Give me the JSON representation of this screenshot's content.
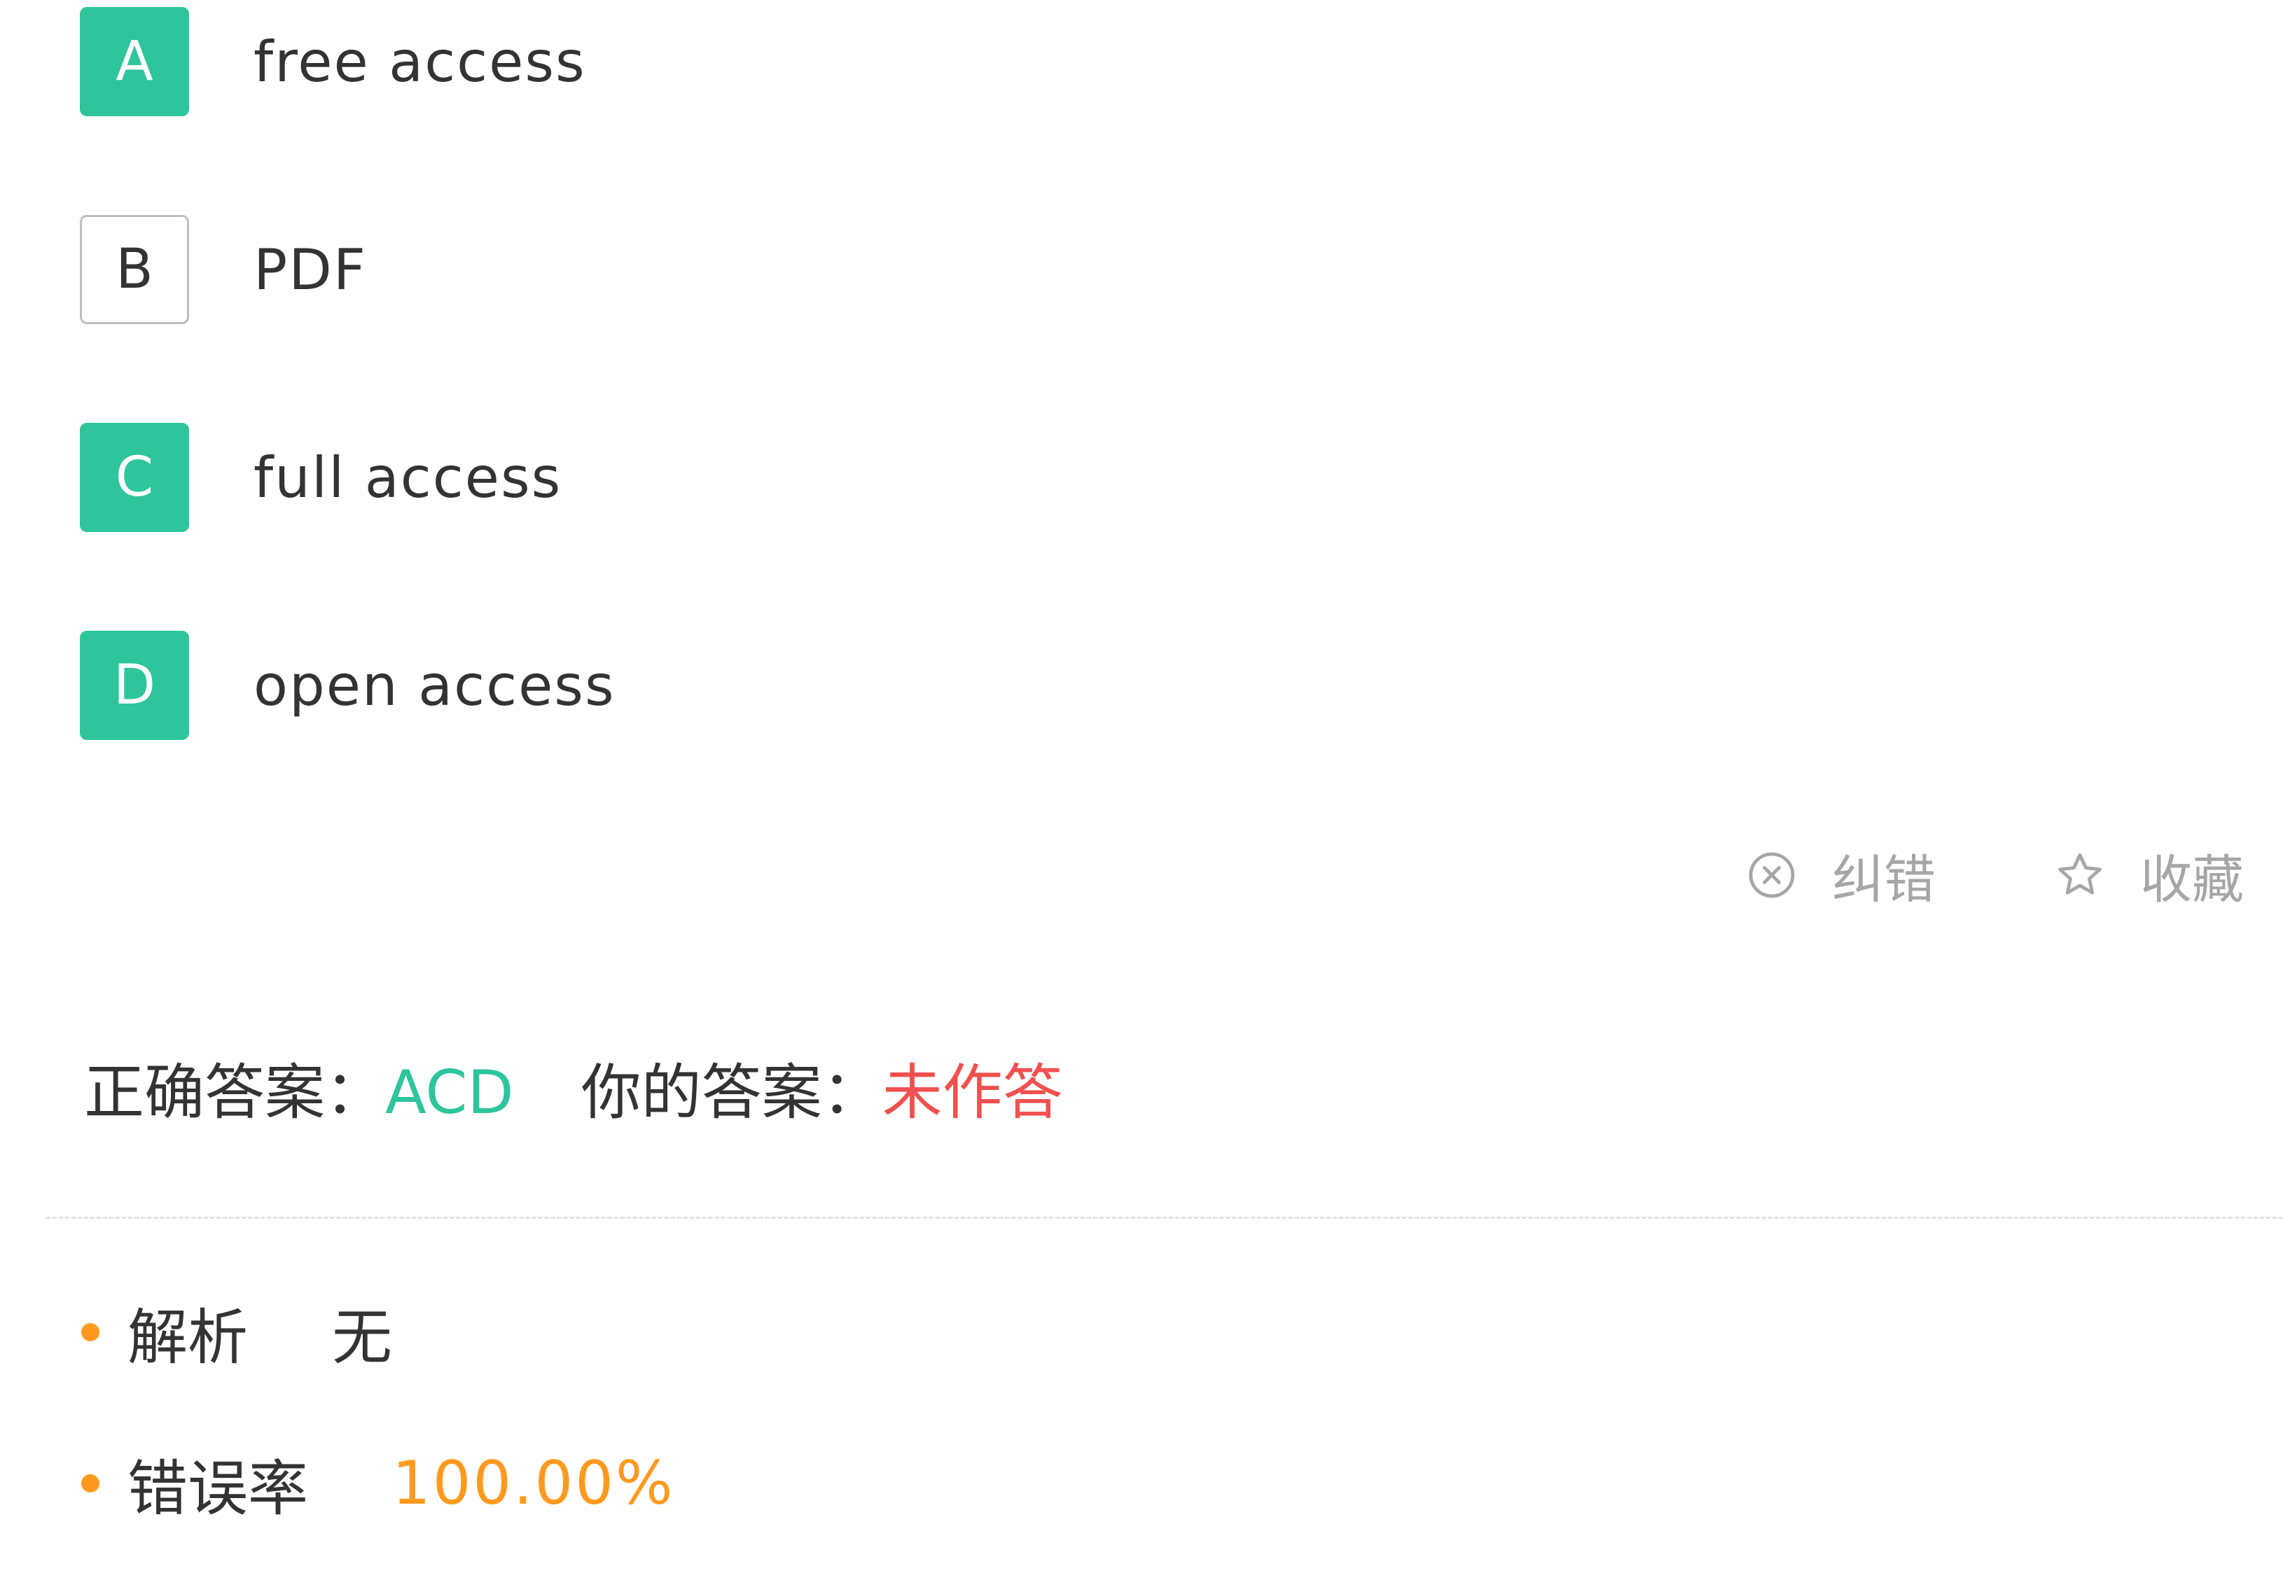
{
  "options": [
    {
      "letter": "A",
      "text": "free access",
      "selected": true
    },
    {
      "letter": "B",
      "text": "PDF",
      "selected": false
    },
    {
      "letter": "C",
      "text": "full access",
      "selected": true
    },
    {
      "letter": "D",
      "text": "open access",
      "selected": true
    }
  ],
  "actions": {
    "report_label": "纠错",
    "report_icon": "close-circle-icon",
    "favorite_label": "收藏",
    "favorite_icon": "star-outline-icon"
  },
  "answer": {
    "correct_label": "正确答案：",
    "correct_value": "ACD",
    "yours_label": "你的答案：",
    "yours_value": "未作答"
  },
  "analysis": {
    "label": "解析",
    "value": "无"
  },
  "error_rate": {
    "label": "错误率",
    "value": "100.00%"
  },
  "colors": {
    "accent_green": "#2ec49c",
    "answer_red": "#f0504f",
    "highlight_orange": "#ff9a1e",
    "muted_gray": "#a6a6a6"
  }
}
